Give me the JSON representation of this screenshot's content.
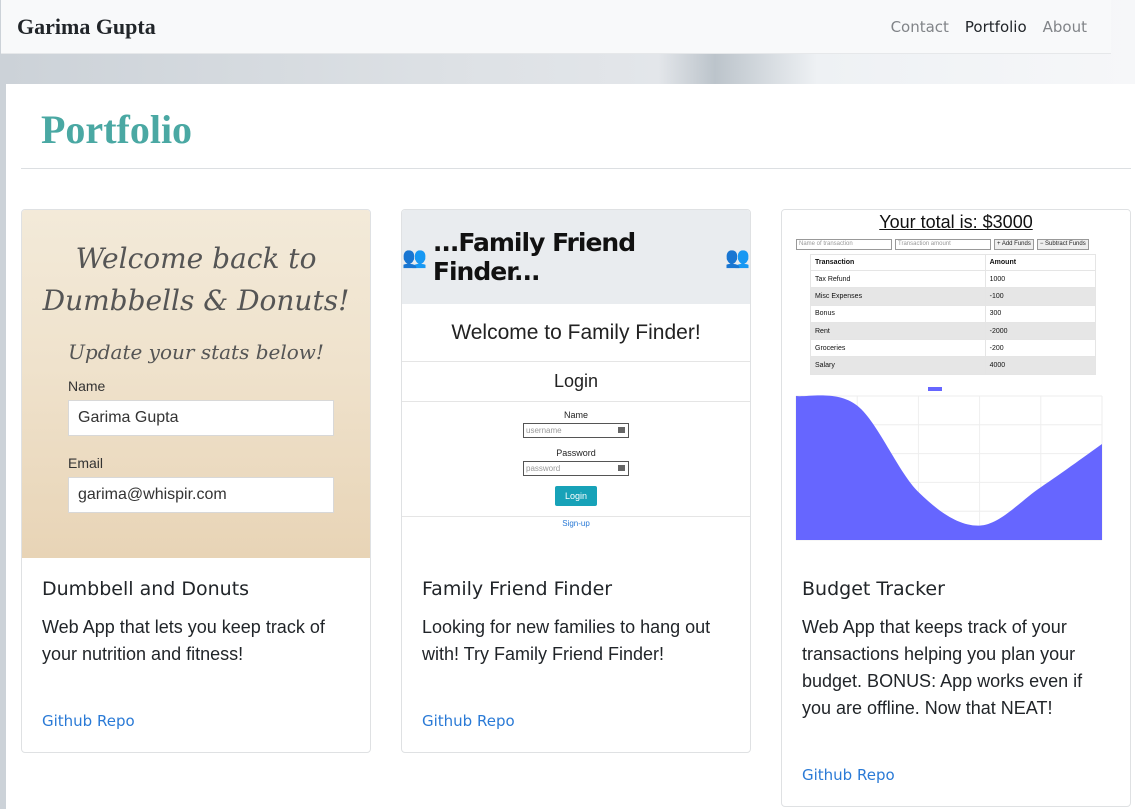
{
  "navbar": {
    "brand": "Garima Gupta",
    "links": [
      {
        "label": "Contact",
        "active": false
      },
      {
        "label": "Portfolio",
        "active": true
      },
      {
        "label": "About",
        "active": false
      }
    ]
  },
  "page": {
    "title": "Portfolio"
  },
  "cards": [
    {
      "title": "Dumbbell and Donuts",
      "text": "Web App that lets you keep track of your nutrition and fitness!",
      "link": "Github Repo",
      "screenshot": {
        "line1": "Welcome back to",
        "line2": "Dumbbells & Donuts!",
        "line3": "Update your stats below!",
        "name_label": "Name",
        "name_value": "Garima Gupta",
        "email_label": "Email",
        "email_value": "garima@whispir.com"
      }
    },
    {
      "title": "Family Friend Finder",
      "text": "Looking for new families to hang out with! Try Family Friend Finder!",
      "link": "Github Repo",
      "screenshot": {
        "banner": "...Family Friend Finder...",
        "welcome": "Welcome to Family Finder!",
        "login_heading": "Login",
        "name_label": "Name",
        "username_placeholder": "username",
        "password_label": "Password",
        "password_placeholder": "password",
        "login_button": "Login",
        "signup_link": "Sign-up"
      }
    },
    {
      "title": "Budget Tracker",
      "text": "Web App that keeps track of your transactions helping you plan your budget. BONUS: App works even if you are offline. Now that NEAT!",
      "link": "Github Repo",
      "screenshot": {
        "total": "Your total is: $3000",
        "name_placeholder": "Name of transaction",
        "amount_placeholder": "Transaction amount",
        "add_button": "+ Add Funds",
        "subtract_button": "− Subtract Funds",
        "table_headers": [
          "Transaction",
          "Amount"
        ],
        "table_rows": [
          [
            "Tax Refund",
            "1000"
          ],
          [
            "Misc Expenses",
            "-100"
          ],
          [
            "Bonus",
            "300"
          ],
          [
            "Rent",
            "-2000"
          ],
          [
            "Groceries",
            "-200"
          ],
          [
            "Salary",
            "4000"
          ]
        ],
        "chart_color": "#6666ff",
        "chart_values": [
          3000,
          2800,
          1000,
          300,
          1100,
          2000
        ]
      }
    }
  ]
}
